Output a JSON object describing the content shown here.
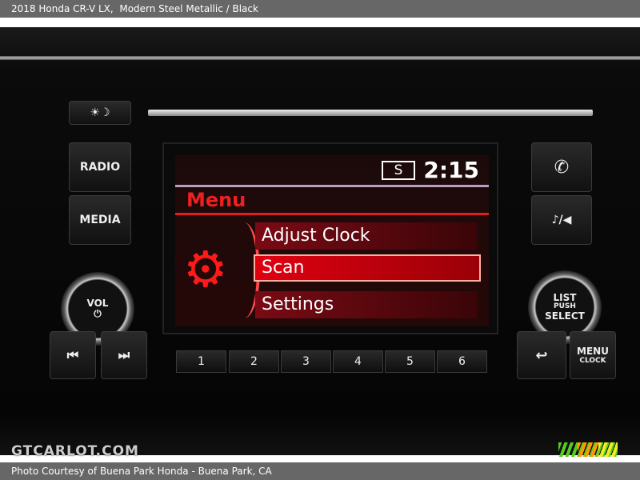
{
  "header": {
    "title": "2018 Honda CR-V LX,  Modern Steel Metallic / Black"
  },
  "footer": {
    "credit": "Photo Courtesy of Buena Park Honda - Buena Park, CA"
  },
  "watermark": {
    "logo": "GTCARLOT.COM"
  },
  "radio": {
    "left_buttons": {
      "brightness": "☀☽",
      "radio": "RADIO",
      "media": "MEDIA",
      "vol_label": "VOL",
      "power": "⏻",
      "prev": "⏮",
      "next": "⏭"
    },
    "right_buttons": {
      "phone": "✆",
      "music": "♪/◀",
      "list": "LIST",
      "push": "PUSH",
      "select": "SELECT",
      "back": "↩",
      "menu": "MENU",
      "clock": "CLOCK"
    },
    "screen": {
      "mode_badge": "S",
      "time": "2:15",
      "title": "Menu",
      "gear": "⚙",
      "items": [
        "Adjust Clock",
        "Scan",
        "Settings"
      ],
      "selected": "Scan"
    },
    "presets": [
      "1",
      "2",
      "3",
      "4",
      "5",
      "6"
    ]
  }
}
